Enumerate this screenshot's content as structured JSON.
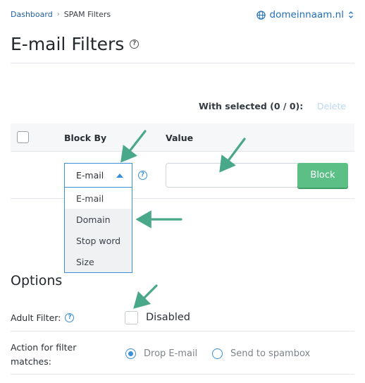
{
  "header": {
    "breadcrumb": [
      "Dashboard",
      "SPAM Filters"
    ],
    "domain": "domeinnaam.nl",
    "title": "E-mail Filters"
  },
  "bulk": {
    "with_selected": "With selected (0 / 0):",
    "delete_label": "Delete"
  },
  "table": {
    "headers": {
      "block_by": "Block By",
      "value": "Value"
    },
    "select_value": "E-mail",
    "options": [
      "E-mail",
      "Domain",
      "Stop word",
      "Size"
    ],
    "value_input": "",
    "block_label": "Block"
  },
  "options": {
    "title": "Options",
    "adult_filter_label": "Adult Filter:",
    "adult_filter_value": "Disabled",
    "action_label_line1": "Action for filter",
    "action_label_line2": "matches:",
    "action_choices": [
      "Drop E-mail",
      "Send to spambox"
    ]
  },
  "colors": {
    "accent": "#3a8fd6",
    "block_button": "#5bbf86",
    "annotation_arrow": "#4aa88a"
  },
  "icons": {
    "globe": "globe-icon",
    "updown": "chevron-updown-icon",
    "help": "help-circle-icon",
    "breadcrumb_sep": "chevron-right-icon"
  }
}
